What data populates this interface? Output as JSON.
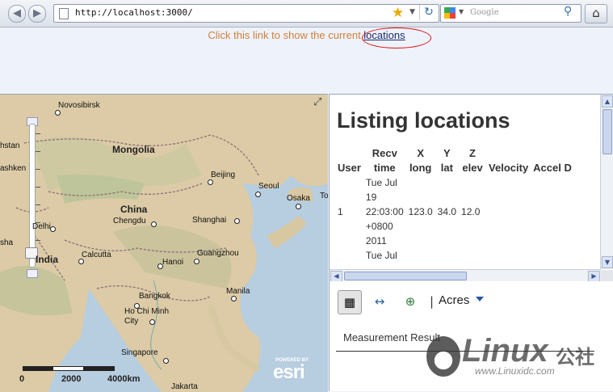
{
  "browser": {
    "url": "http://localhost:3000/",
    "search_placeholder": "Google",
    "icons": [
      "back-icon",
      "forward-icon",
      "star-icon",
      "reload-icon",
      "google-icon",
      "magnifier-icon",
      "home-icon"
    ]
  },
  "header": {
    "text": "Click this link to show the current ",
    "link_label": "locations"
  },
  "map": {
    "cities_big": [
      "Mongolia",
      "China",
      "India"
    ],
    "cities": [
      "Novosibirsk",
      "Beijing",
      "Seoul",
      "Osaka",
      "Chengdu",
      "Shanghai",
      "Delhi",
      "Calcutta",
      "Hanoi",
      "Guangzhou",
      "Manila",
      "Bangkok",
      "Ho Chi Minh City",
      "Singapore",
      "Jakarta"
    ],
    "edge_labels": [
      "hstan",
      "ashken",
      "sha",
      "To"
    ],
    "scale": {
      "labels": [
        "0",
        "2000",
        "4000km"
      ]
    },
    "logo_tag": "POWERED BY",
    "logo": "esri"
  },
  "listing": {
    "title": "Listing locations",
    "columns": [
      "User",
      "Recv time",
      "X long",
      "Y lat",
      "Z elev",
      "Velocity",
      "Accel D"
    ],
    "rows": [
      {
        "user": "1",
        "recv_time": [
          "Tue Jul",
          "19",
          "22:03:00",
          "+0800",
          "2011"
        ],
        "x": "123.0",
        "y": "34.0",
        "z": "12.0"
      },
      {
        "recv_time_partial": "Tue Jul"
      }
    ]
  },
  "measurement": {
    "unit": "Acres",
    "result_label": "Measurement Result"
  },
  "watermark": {
    "brand": "Linux",
    "cn": "公社",
    "url": "www.Linuxidc.com"
  },
  "colors": {
    "header_text": "#d2803a",
    "link": "#1c2a6e",
    "highlight_ellipse": "#dd1111"
  }
}
